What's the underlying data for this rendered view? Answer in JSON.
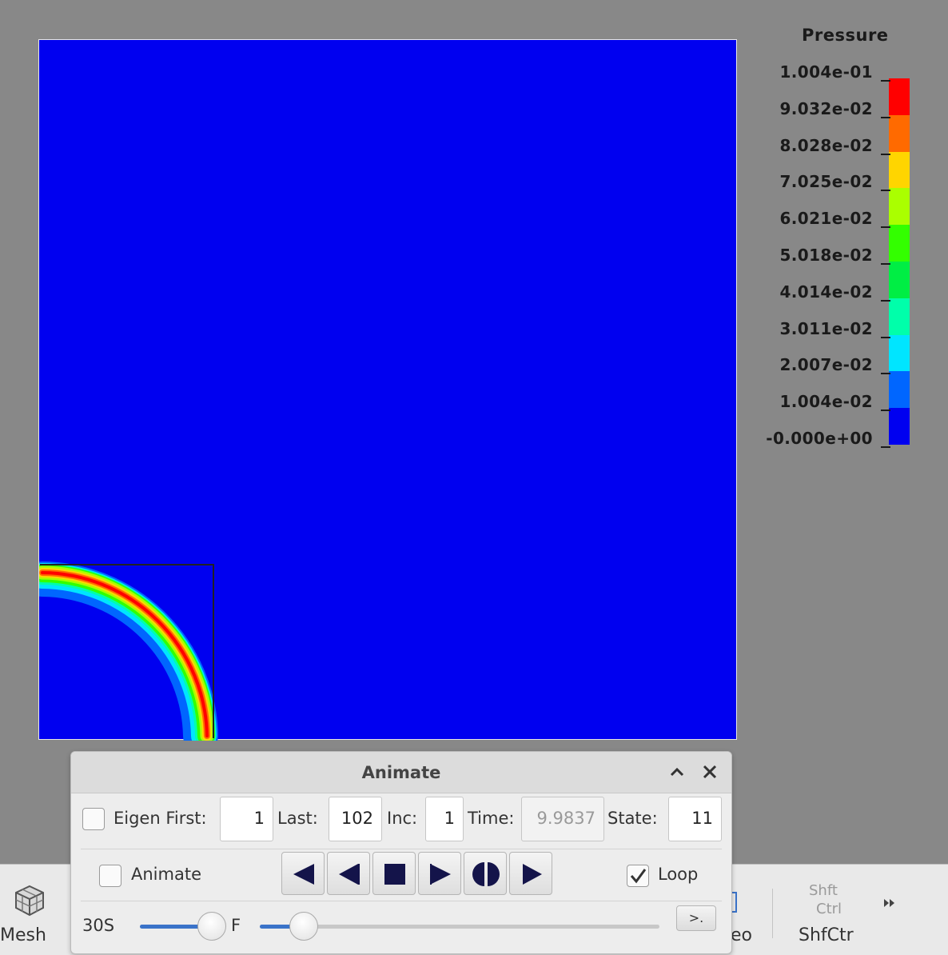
{
  "legend": {
    "title": "Pressure",
    "labels": [
      "1.004e-01",
      "9.032e-02",
      "8.028e-02",
      "7.025e-02",
      "6.021e-02",
      "5.018e-02",
      "4.014e-02",
      "3.011e-02",
      "2.007e-02",
      "1.004e-02",
      "-0.000e+00"
    ],
    "colors": [
      "#ff0000",
      "#ff6a00",
      "#ffd500",
      "#aaff00",
      "#33ff00",
      "#00ee44",
      "#00ffaa",
      "#00e5ff",
      "#0066ff",
      "#0000f0"
    ]
  },
  "viewport": {
    "background": "#0000f0"
  },
  "toolbar": {
    "mesh_label": "Mesh",
    "video_label_partial": "eo",
    "shift_label": "Shft",
    "ctrl_label": "Ctrl",
    "shfctr_label": "ShfCtr"
  },
  "animate": {
    "title": "Animate",
    "eigen_label": "Eigen First:",
    "eigen_checked": false,
    "first_value": "1",
    "last_label": "Last:",
    "last_value": "102",
    "inc_label": "Inc:",
    "inc_value": "1",
    "time_label": "Time:",
    "time_value": "9.9837",
    "state_label": "State:",
    "state_value": "11",
    "animate_label": "Animate",
    "animate_checked": false,
    "loop_label": "Loop",
    "loop_checked": true,
    "speed_left_label": "30S",
    "speed_right_label": "F",
    "speed_fraction": 0.85,
    "frame_fraction": 0.11,
    "cmd_label": ">."
  }
}
